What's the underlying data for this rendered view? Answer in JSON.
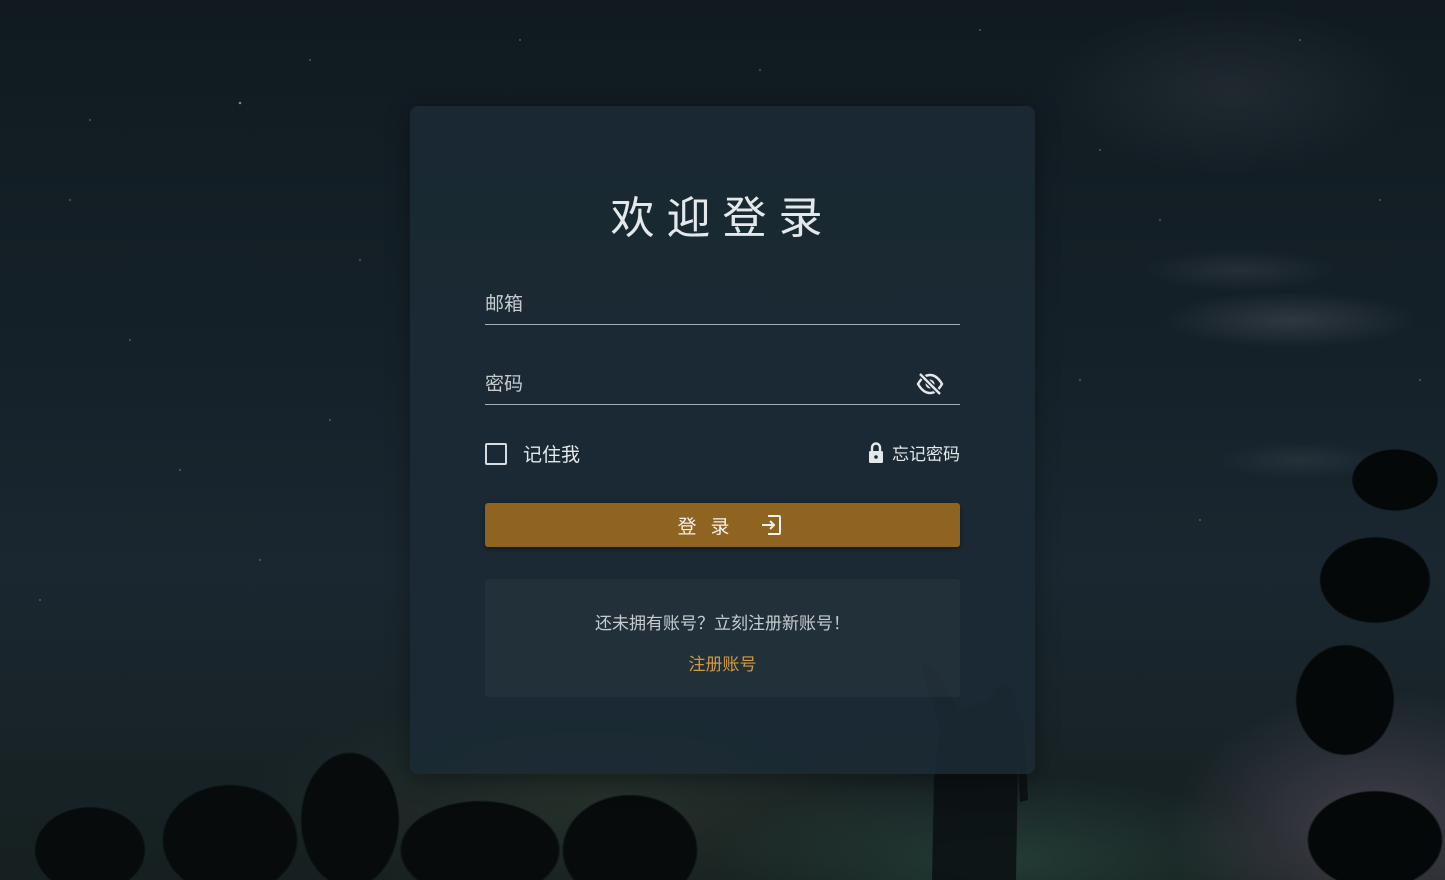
{
  "login": {
    "title": "欢迎登录",
    "email_placeholder": "邮箱",
    "password_placeholder": "密码",
    "remember_label": "记住我",
    "forgot_label": "忘记密码",
    "login_button_label": "登录",
    "register_prompt": "还未拥有账号？立刻注册新账号！",
    "register_link": "注册账号"
  },
  "icons": {
    "visibility_toggle": "eye-off-icon",
    "forgot_password": "lock-icon",
    "login": "login-icon"
  },
  "colors": {
    "login_button": "#8f6320",
    "register_link": "#d49a3a",
    "card_background": "#1b2a34"
  }
}
